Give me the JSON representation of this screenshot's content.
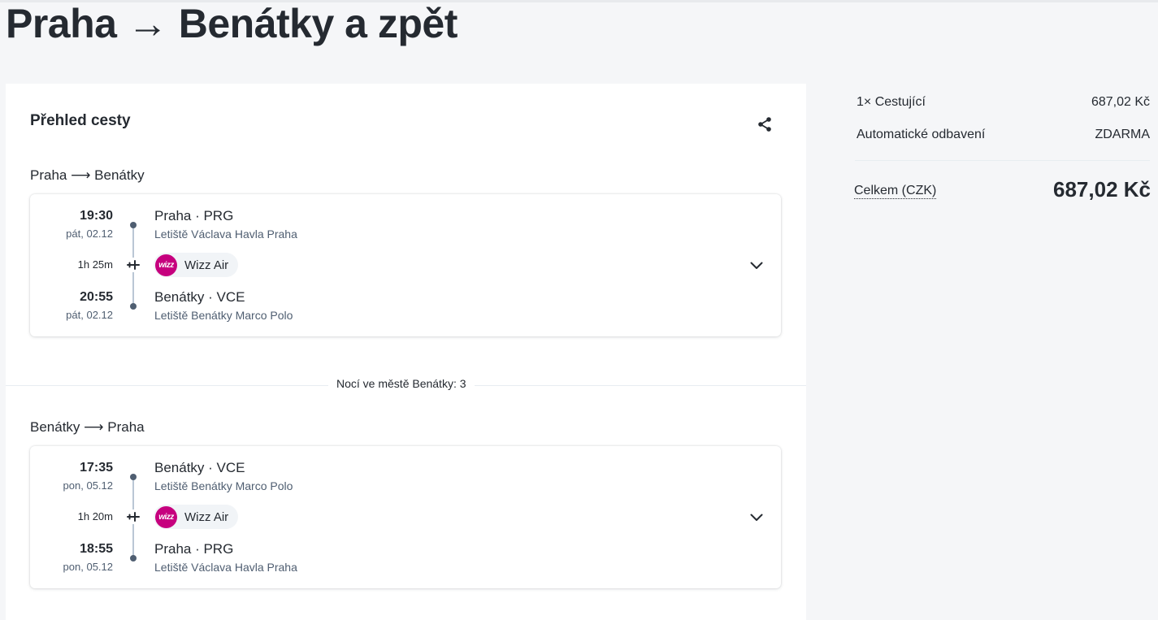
{
  "page": {
    "title": "Praha → Benátky a zpět"
  },
  "overview": {
    "title": "Přehled cesty",
    "share_icon": "share-icon",
    "nights": "Nocí ve městě Benátky: 3"
  },
  "segments": [
    {
      "title": "Praha ⟶ Benátky",
      "departure": {
        "time": "19:30",
        "date": "pát, 02.12",
        "station": "Praha · PRG",
        "airport": "Letiště Václava Havla Praha"
      },
      "duration": "1h 25m",
      "carrier": {
        "name": "Wizz Air",
        "logo_text": "wizz"
      },
      "arrival": {
        "time": "20:55",
        "date": "pát, 02.12",
        "station": "Benátky · VCE",
        "airport": "Letiště Benátky Marco Polo"
      }
    },
    {
      "title": "Benátky ⟶ Praha",
      "departure": {
        "time": "17:35",
        "date": "pon, 05.12",
        "station": "Benátky · VCE",
        "airport": "Letiště Benátky Marco Polo"
      },
      "duration": "1h 20m",
      "carrier": {
        "name": "Wizz Air",
        "logo_text": "wizz"
      },
      "arrival": {
        "time": "18:55",
        "date": "pon, 05.12",
        "station": "Praha · PRG",
        "airport": "Letiště Václava Havla Praha"
      }
    }
  ],
  "summary": {
    "passengers_label": "1× Cestující",
    "passengers_price": "687,02 Kč",
    "checkin_label": "Automatické odbavení",
    "checkin_price": "ZDARMA",
    "total_label": "Celkem (CZK)",
    "total_value": "687,02 Kč"
  },
  "colors": {
    "accent_carrier": "#c6007e",
    "text_primary": "#252a31",
    "text_secondary": "#4f5e71",
    "background": "#f5f6f8"
  }
}
